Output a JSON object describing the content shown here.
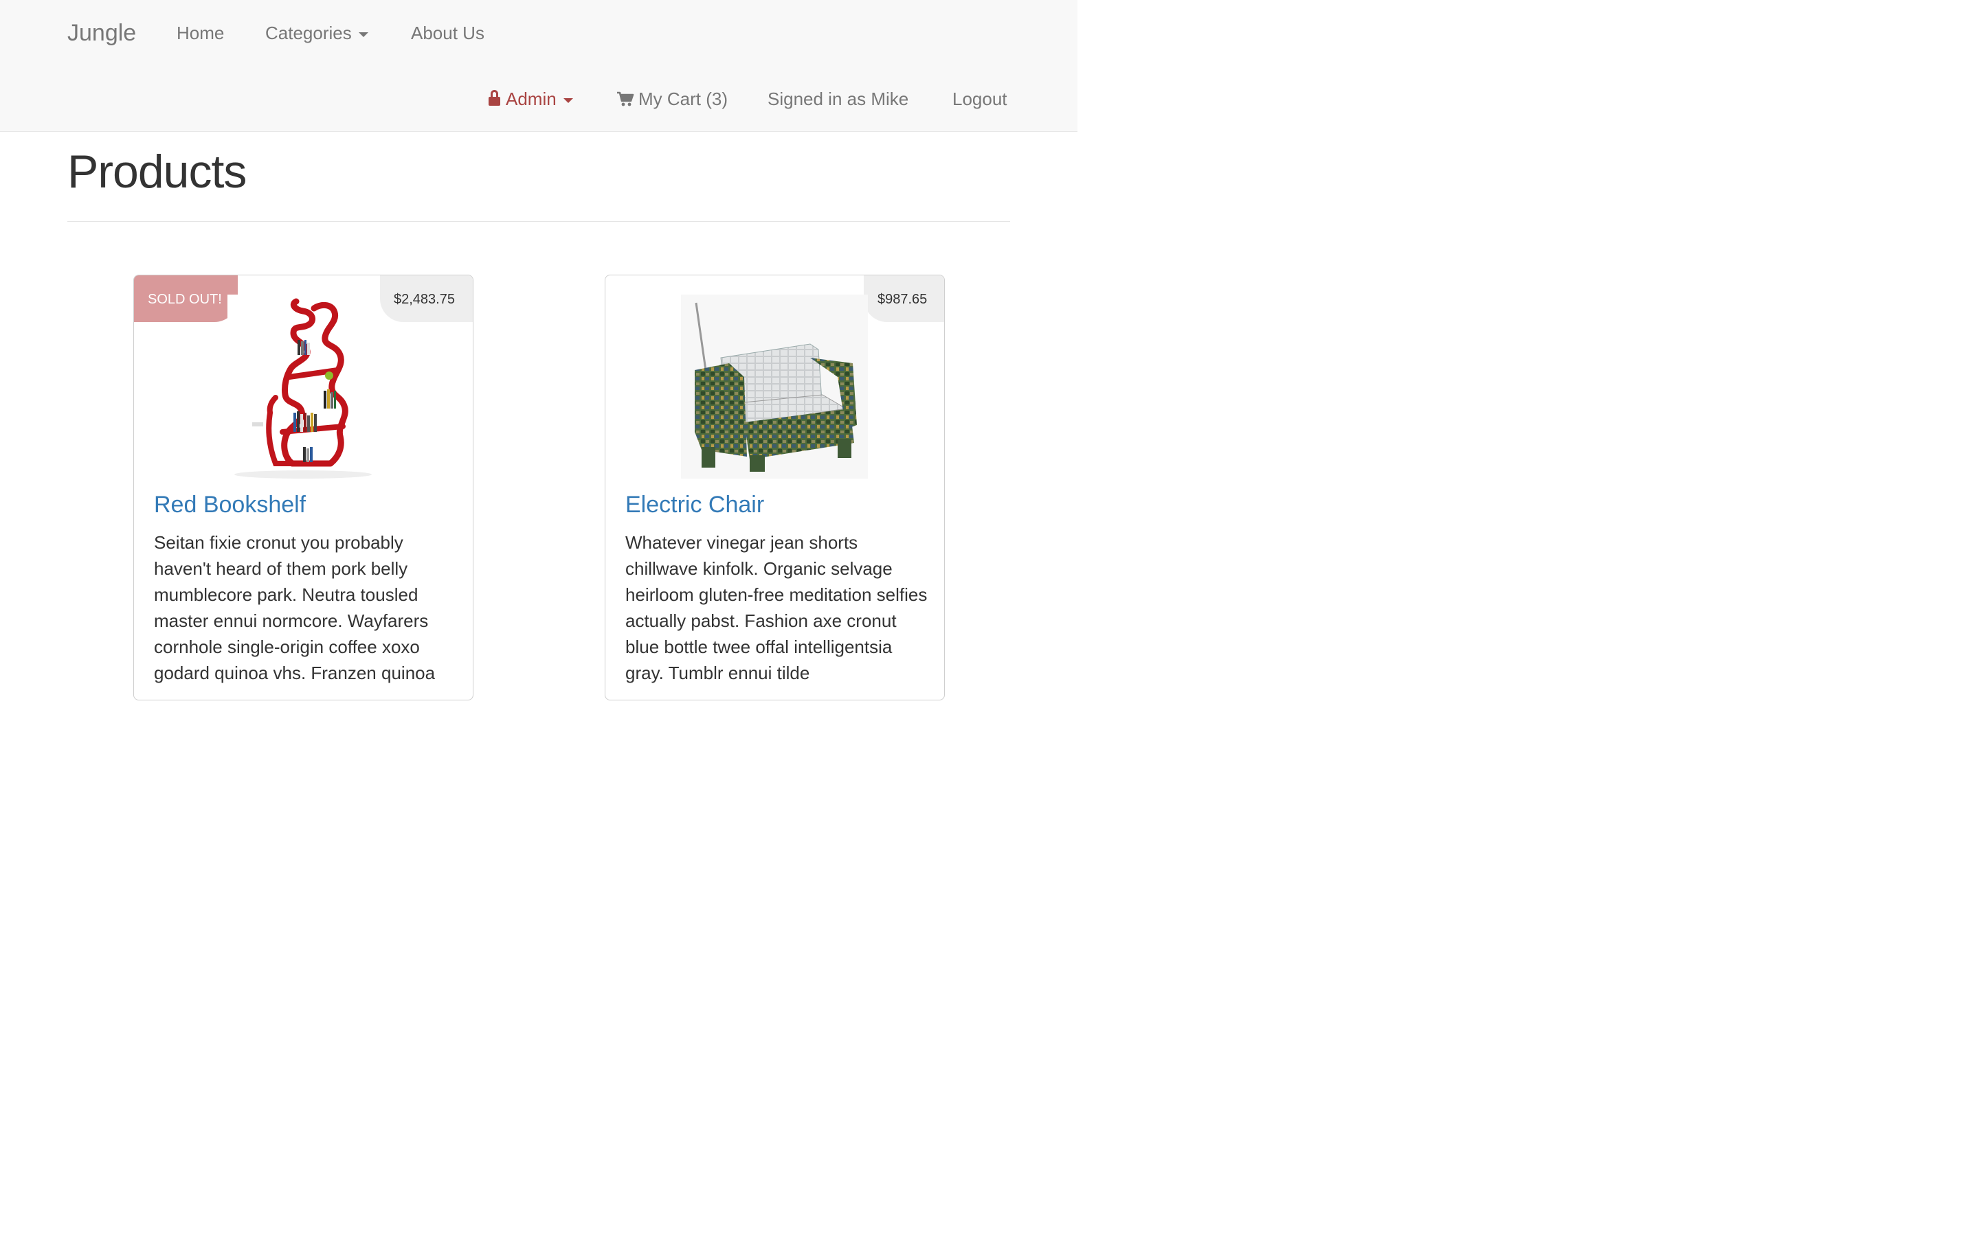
{
  "navbar": {
    "brand": "Jungle",
    "links": {
      "home": "Home",
      "categories": "Categories",
      "about": "About Us",
      "admin": "Admin",
      "cart": "My Cart (3)",
      "signed_in": "Signed in as Mike",
      "logout": "Logout"
    },
    "icons": {
      "admin": "lock-icon",
      "cart": "shopping-cart-icon",
      "dropdown": "caret-down-icon"
    }
  },
  "page": {
    "title": "Products"
  },
  "products": [
    {
      "name": "Red Bookshelf",
      "price": "$2,483.75",
      "badge": "SOLD OUT!",
      "image": "red-bookshelf-image",
      "description": "Seitan fixie cronut you probably haven't heard of them pork belly mumblecore park. Neutra tousled master ennui normcore. Wayfarers cornhole single-origin coffee xoxo godard quinoa vhs. Franzen quinoa"
    },
    {
      "name": "Electric Chair",
      "price": "$987.65",
      "badge": "",
      "image": "electric-chair-image",
      "description": "Whatever vinegar jean shorts chillwave kinfolk. Organic selvage heirloom gluten-free meditation selfies actually pabst. Fashion axe cronut blue bottle twee offal intelligentsia gray. Tumblr ennui tilde"
    }
  ],
  "colors": {
    "navbar_bg": "#f8f8f8",
    "nav_text": "#777777",
    "admin_accent": "#a94442",
    "link_blue": "#337ab7",
    "sold_out_badge": "#d9999a",
    "price_tag_bg": "#eeeeee"
  }
}
